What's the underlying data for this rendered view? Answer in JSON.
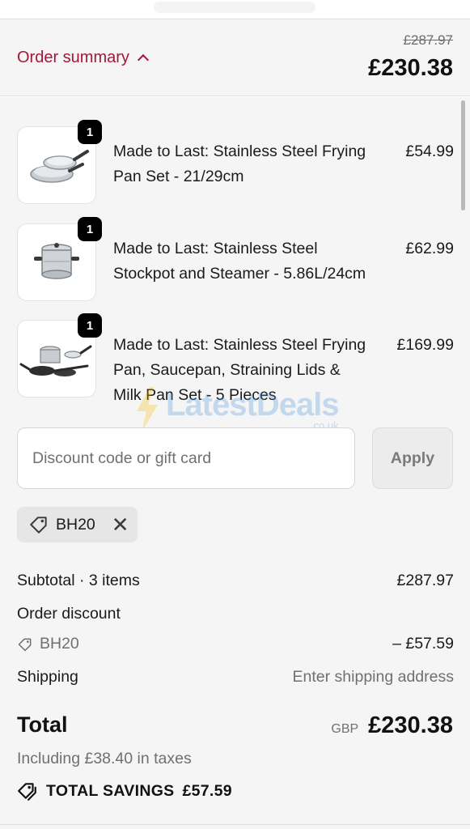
{
  "summary": {
    "toggle_label": "Order summary",
    "original_price": "£287.97",
    "current_price": "£230.38"
  },
  "items": [
    {
      "qty": "1",
      "name": "Made to Last: Stainless Steel Frying Pan Set - 21/29cm",
      "price": "£54.99",
      "image_icon": "frying-pan-set-image"
    },
    {
      "qty": "1",
      "name": "Made to Last: Stainless Steel Stockpot and Steamer - 5.86L/24cm",
      "price": "£62.99",
      "image_icon": "stockpot-image"
    },
    {
      "qty": "1",
      "name": "Made to Last: Stainless Steel Frying Pan, Saucepan, Straining Lids & Milk Pan Set - 5 Pieces",
      "price": "£169.99",
      "image_icon": "pan-set-image"
    }
  ],
  "discount": {
    "placeholder": "Discount code or gift card",
    "value": "",
    "apply_label": "Apply",
    "applied_code": "BH20"
  },
  "breakdown": {
    "subtotal_label": "Subtotal · 3 items",
    "subtotal_value": "£287.97",
    "discount_label": "Order discount",
    "discount_code": "BH20",
    "discount_value": "– £57.59",
    "shipping_label": "Shipping",
    "shipping_value": "Enter shipping address"
  },
  "total": {
    "label": "Total",
    "currency": "GBP",
    "amount": "£230.38",
    "taxes": "Including £38.40 in taxes",
    "savings_label": "TOTAL SAVINGS",
    "savings_value": "£57.59"
  },
  "watermark": {
    "text": "LatestDeals",
    "sub": ".co.uk"
  },
  "colors": {
    "accent": "#a3173c",
    "background": "#f5f5f5"
  }
}
